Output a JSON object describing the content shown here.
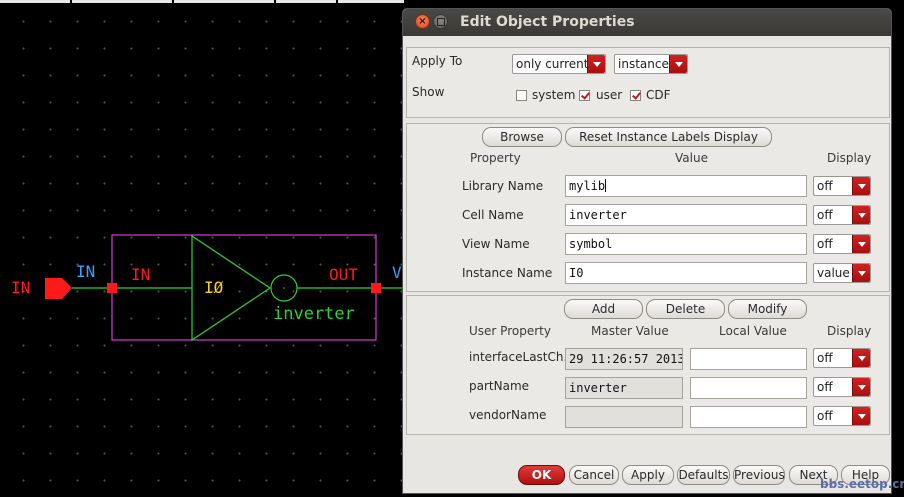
{
  "dialog": {
    "title": "Edit Object Properties",
    "apply_to": {
      "label": "Apply To",
      "scope_value": "only current",
      "target_value": "instance"
    },
    "show": {
      "label": "Show",
      "options": [
        {
          "label": "system",
          "checked": false
        },
        {
          "label": "user",
          "checked": true
        },
        {
          "label": "CDF",
          "checked": true
        }
      ]
    },
    "attributes": {
      "browse_label": "Browse",
      "reset_label": "Reset Instance Labels Display",
      "headers": {
        "property": "Property",
        "value": "Value",
        "display": "Display"
      },
      "rows": [
        {
          "property": "Library Name",
          "value": "mylib",
          "display": "off"
        },
        {
          "property": "Cell Name",
          "value": "inverter",
          "display": "off"
        },
        {
          "property": "View Name",
          "value": "symbol",
          "display": "off"
        },
        {
          "property": "Instance Name",
          "value": "I0",
          "display": "value"
        }
      ]
    },
    "user_props": {
      "add_label": "Add",
      "delete_label": "Delete",
      "modify_label": "Modify",
      "headers": {
        "property": "User Property",
        "master": "Master Value",
        "local": "Local Value",
        "display": "Display"
      },
      "rows": [
        {
          "property": "interfaceLastCh..",
          "master": "29 11:26:57 2013",
          "local": "",
          "display": "off"
        },
        {
          "property": "partName",
          "master": "inverter",
          "local": "",
          "display": "off"
        },
        {
          "property": "vendorName",
          "master": "",
          "local": "",
          "display": "off"
        }
      ]
    },
    "footer": [
      "OK",
      "Cancel",
      "Apply",
      "Defaults",
      "Previous",
      "Next",
      "Help"
    ]
  },
  "schematic": {
    "pin_label": "IN",
    "wire_label": "IN",
    "symbol_in_label": "IN",
    "symbol_out_label": "OUT",
    "out_wire_label": "V",
    "instance_label": "IØ",
    "cell_label": "inverter"
  },
  "watermark": "bbs.eetop.cn",
  "colors": {
    "pin": "#ff1a1a",
    "wire_label": "#3aa0ff",
    "symbol_box": "#d63ad6",
    "symbol_body": "#2fd12f",
    "instance_label": "#ffd21a",
    "accent": "#c81616"
  }
}
